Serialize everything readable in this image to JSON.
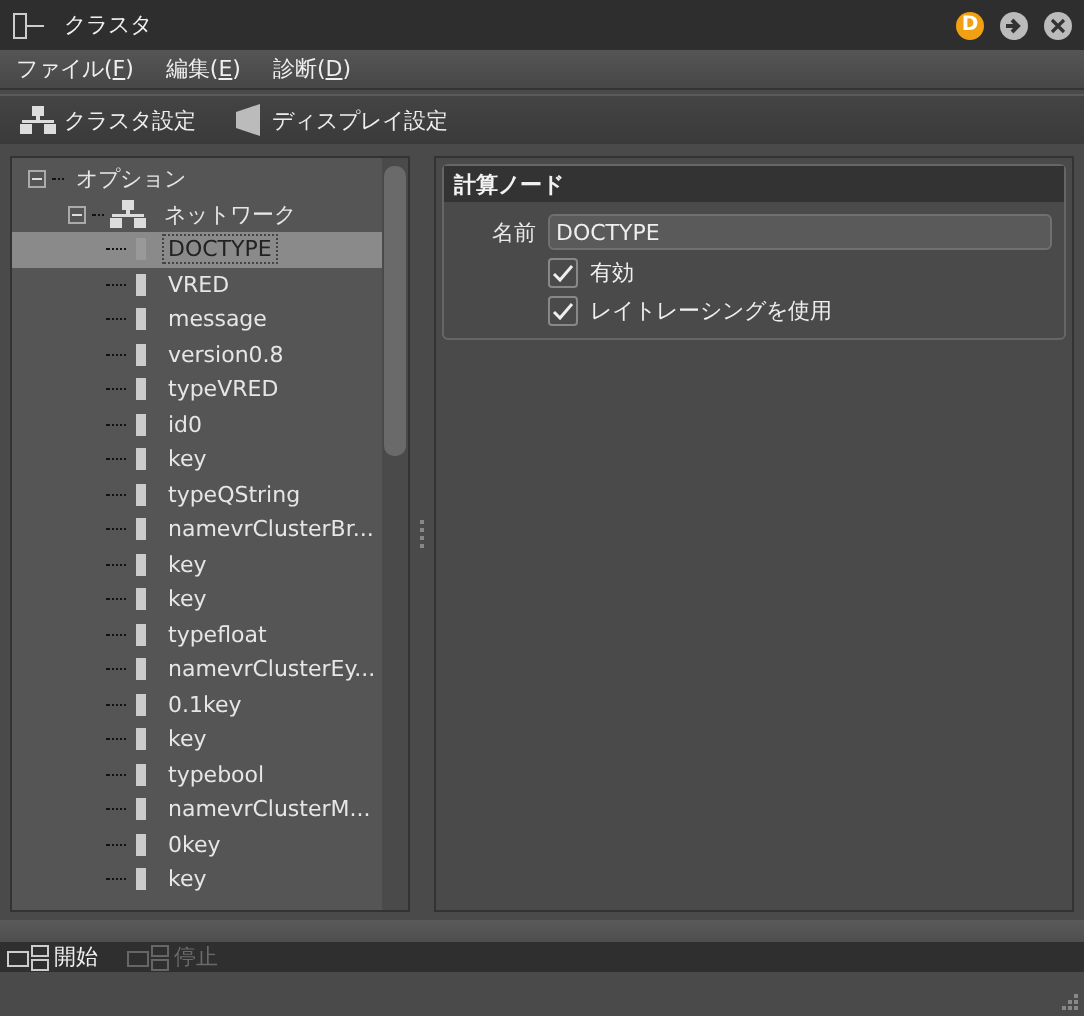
{
  "window": {
    "title": "クラスタ",
    "badge": "D"
  },
  "menu": [
    {
      "label": "ファイル(",
      "key": "F",
      "end": ")"
    },
    {
      "label": "編集(",
      "key": "E",
      "end": ")"
    },
    {
      "label": "診断(",
      "key": "D",
      "end": ")"
    }
  ],
  "toolbar": [
    {
      "label": "クラスタ設定",
      "kind": "network"
    },
    {
      "label": "ディスプレイ設定",
      "kind": "display"
    }
  ],
  "tree": [
    {
      "label": "オプション",
      "expanded": true,
      "children": [
        {
          "label": "ネットワーク",
          "expanded": true,
          "children": [
            {
              "label": "DOCTYPE",
              "selected": true
            },
            {
              "label": "VRED",
              "selected": false
            },
            {
              "label": "message",
              "selected": false
            },
            {
              "label": "version0.8",
              "selected": false
            },
            {
              "label": "typeVRED",
              "selected": false
            },
            {
              "label": "id0",
              "selected": false
            },
            {
              "label": "key",
              "selected": false
            },
            {
              "label": "typeQString",
              "selected": false
            },
            {
              "label": "namevrClusterBr...",
              "selected": false
            },
            {
              "label": "key",
              "selected": false
            },
            {
              "label": "key",
              "selected": false
            },
            {
              "label": "typefloat",
              "selected": false
            },
            {
              "label": "namevrClusterEy...",
              "selected": false
            },
            {
              "label": "0.1key",
              "selected": false
            },
            {
              "label": "key",
              "selected": false
            },
            {
              "label": "typebool",
              "selected": false
            },
            {
              "label": "namevrClusterM...",
              "selected": false
            },
            {
              "label": "0key",
              "selected": false
            },
            {
              "label": "key",
              "selected": false
            }
          ]
        }
      ]
    }
  ],
  "node": {
    "title": "計算ノード",
    "name_label": "名前",
    "name_value": "DOCTYPE",
    "options": [
      {
        "label": "有効",
        "checked": true
      },
      {
        "label": "レイトレーシングを使用",
        "checked": true
      }
    ]
  },
  "actions": [
    {
      "label": "開始",
      "disabled": false
    },
    {
      "label": "停止",
      "disabled": true
    }
  ]
}
